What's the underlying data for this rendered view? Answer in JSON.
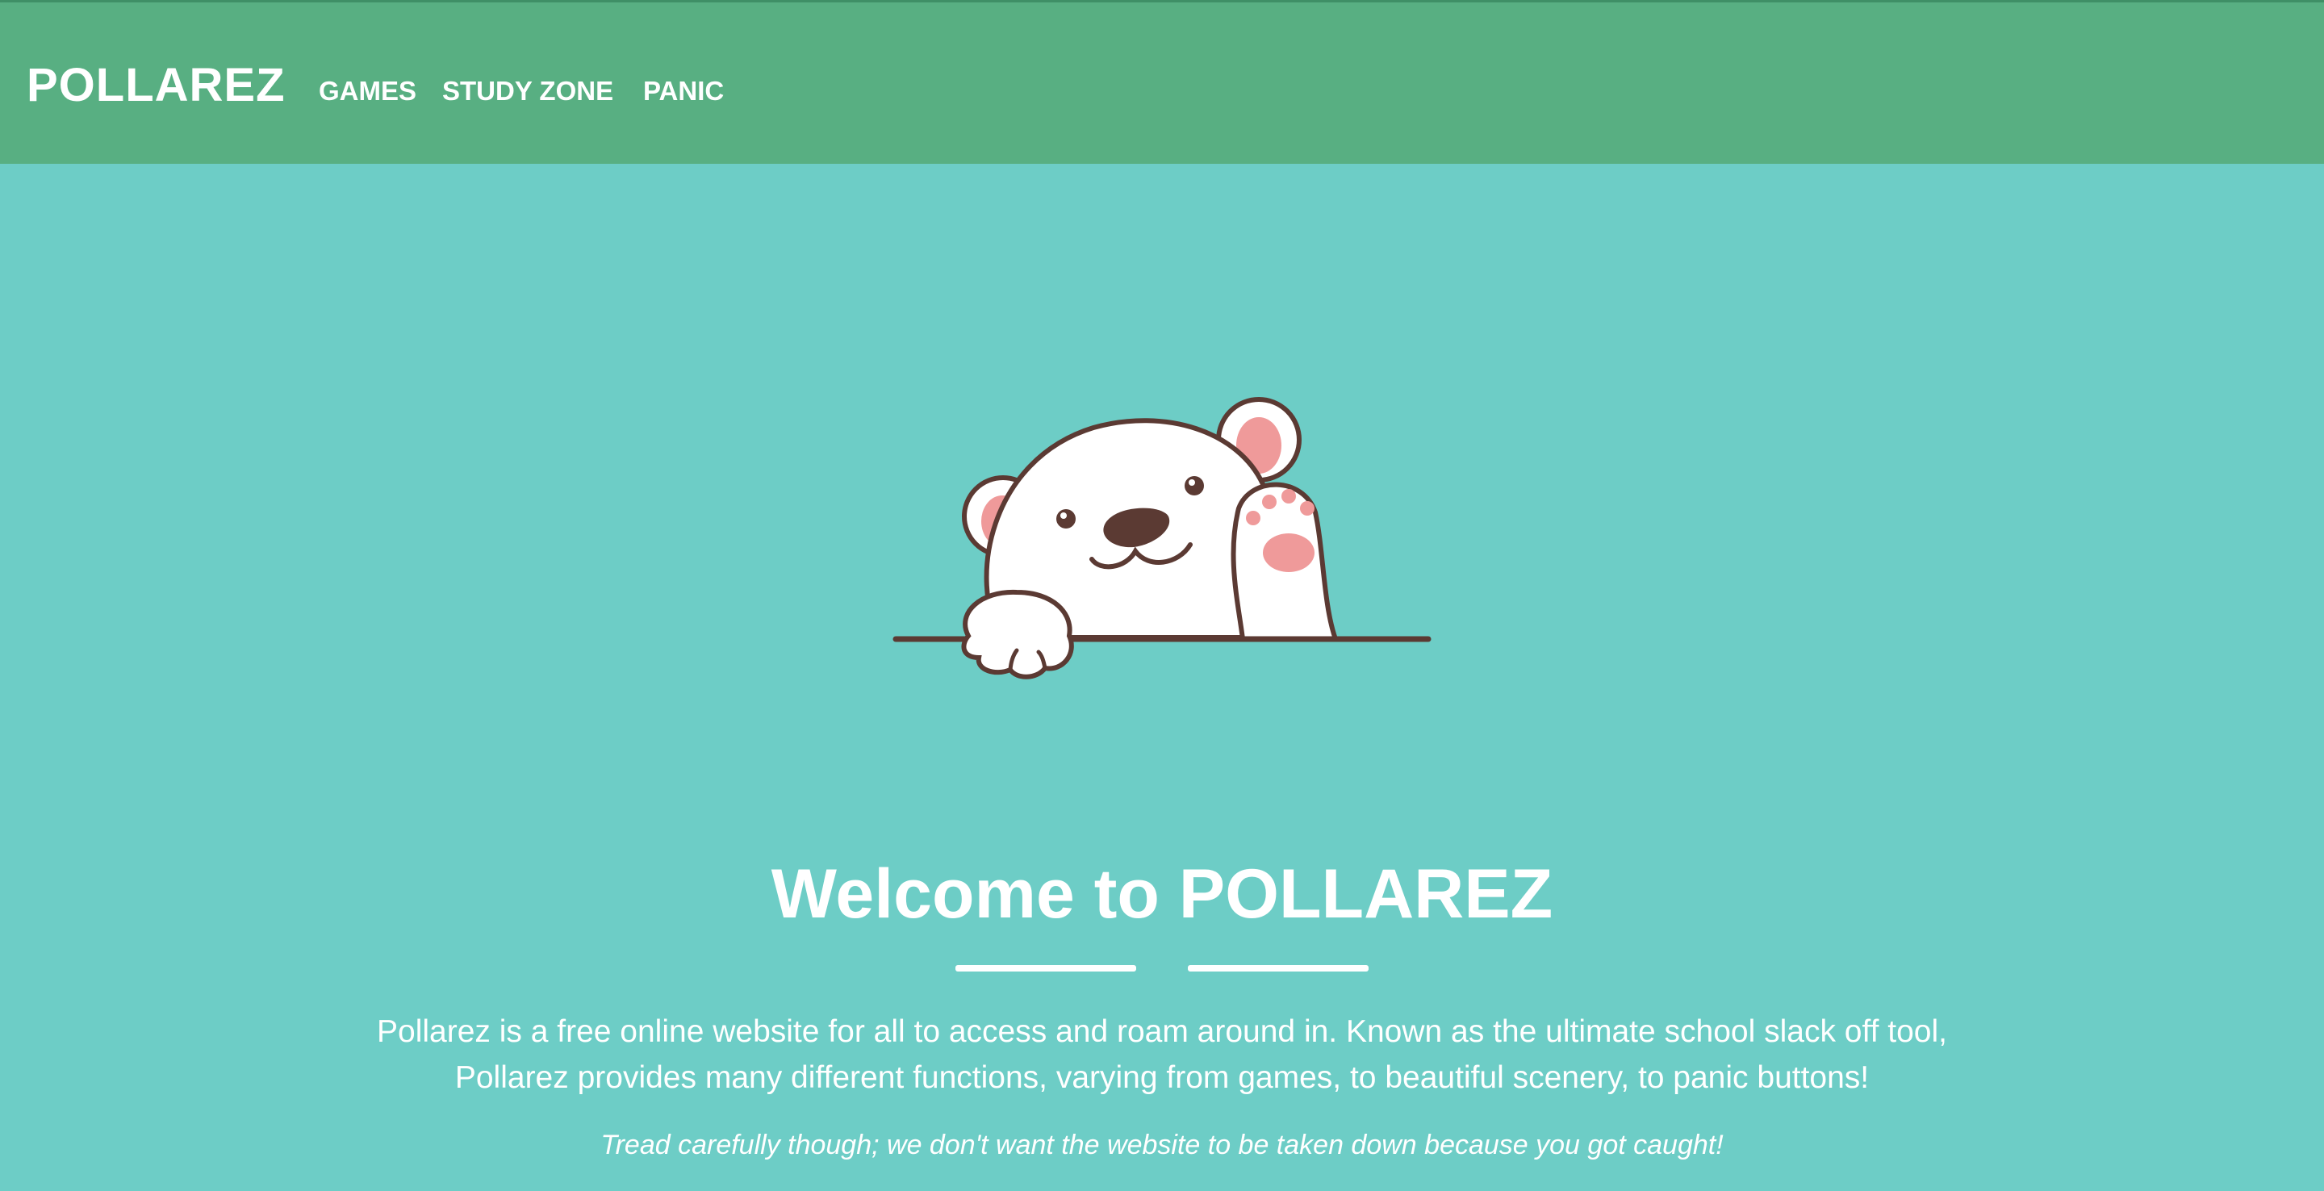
{
  "navbar": {
    "brand": "POLLAREZ",
    "links": [
      "GAMES",
      "STUDY ZONE",
      "PANIC"
    ]
  },
  "hero": {
    "image_icon": "waving-polar-bear-illustration",
    "title": "Welcome to POLLAREZ",
    "description_line1": "Pollarez is a free online website for all to access and roam around in. Known as the ultimate school slack off tool,",
    "description_line2": "Pollarez provides many different functions, varying from games, to beautiful scenery, to panic buttons!",
    "tagline": "Tread carefully though; we don't want the website to be taken down because you got caught!"
  },
  "colors": {
    "navbar_background": "#58af82",
    "page_background": "#6dcdc6",
    "text": "#ffffff",
    "bear_outline": "#5b3a33",
    "bear_pink": "#ef9a9a"
  }
}
